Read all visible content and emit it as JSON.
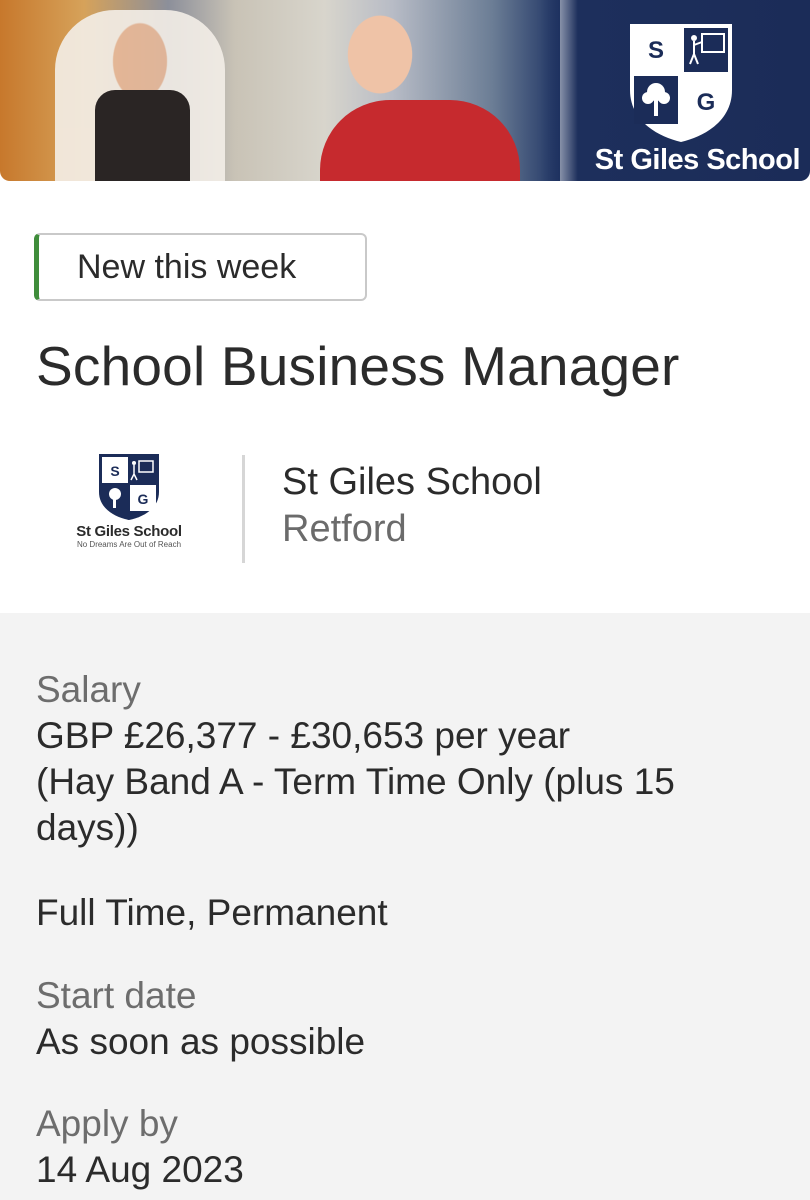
{
  "banner": {
    "school_name": "St Giles School",
    "crest_letters": [
      "S",
      "G"
    ],
    "colors": {
      "navy": "#1b2c58",
      "white": "#ffffff"
    }
  },
  "badge": {
    "label": "New this week",
    "accent": "#3f8d3b"
  },
  "job": {
    "title": "School Business Manager"
  },
  "employer": {
    "logo_name": "St Giles School",
    "logo_tagline": "No Dreams Are Out of Reach",
    "name": "St Giles School",
    "location": "Retford"
  },
  "details": {
    "salary_label": "Salary",
    "salary_line1": "GBP £26,377 - £30,653 per year",
    "salary_line2": "(Hay Band A - Term Time Only (plus 15",
    "salary_line3": "days))",
    "contract": "Full Time, Permanent",
    "start_label": "Start date",
    "start_value": "As soon as possible",
    "apply_label": "Apply by",
    "apply_value": "14 Aug 2023"
  }
}
